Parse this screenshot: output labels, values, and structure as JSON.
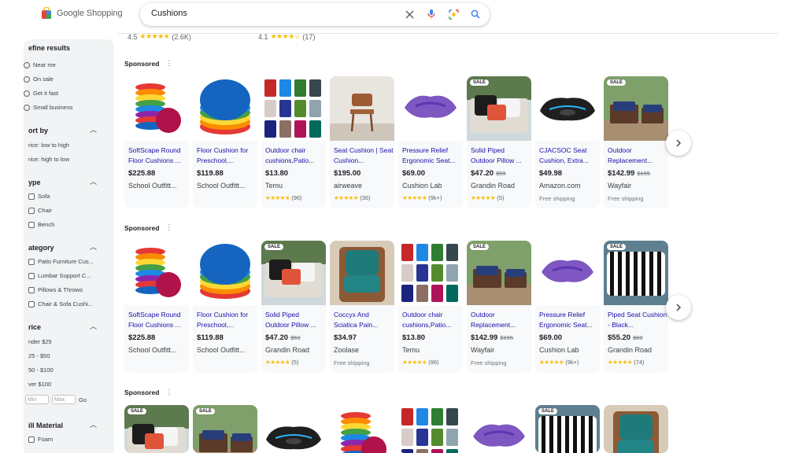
{
  "header": {
    "brand": "Google Shopping",
    "search_value": "Cushions",
    "icons": [
      "close-icon",
      "mic-icon",
      "lens-icon",
      "search-icon"
    ]
  },
  "above_fold": [
    {
      "rating": "4.5",
      "stars": "★★★★★",
      "count": "(2.6K)"
    },
    {
      "rating": "4.1",
      "stars": "★★★★☆",
      "count": "(17)"
    }
  ],
  "sidebar": {
    "title": "efine results",
    "quick": [
      "Near me",
      "On sale",
      "Get it fast",
      "Small business"
    ],
    "sort_heading": "ort by",
    "sort_options": [
      "rice: low to high",
      "rice: high to low"
    ],
    "type_heading": "ype",
    "type_options": [
      "Sofa",
      "Chair",
      "Bench"
    ],
    "category_heading": "ategory",
    "category_options": [
      "Patio Furniture Cus...",
      "Lumbar Support C...",
      "Pillows & Throws",
      "Chair & Sofa Cushi..."
    ],
    "price_heading": "rice",
    "price_options": [
      "nder $25",
      "25 - $50",
      "50 - $100",
      "ver $100"
    ],
    "price_min": "Min",
    "price_max": "Max",
    "price_go": "Go",
    "material_heading": "ill Material",
    "material_options": [
      "Foam"
    ]
  },
  "sponsored_label": "Sponsored",
  "rows": [
    [
      {
        "title": "SoftScape Round Floor Cushions ...",
        "price": "$225.88",
        "old": "",
        "store": "School Outfitt...",
        "stars": "",
        "reviews": "",
        "ship": "",
        "sale": "",
        "img": "stack"
      },
      {
        "title": "Floor Cushion for Preschool,...",
        "price": "$119.88",
        "old": "",
        "store": "School Outfitt...",
        "stars": "",
        "reviews": "",
        "ship": "",
        "sale": "",
        "img": "round"
      },
      {
        "title": "Outdoor chair cushions,Patio...",
        "price": "$13.80",
        "old": "",
        "store": "Temu",
        "stars": "★★★★★",
        "reviews": "(96)",
        "ship": "",
        "sale": "",
        "img": "grid"
      },
      {
        "title": "Seat Cushion | Seat Cushion...",
        "price": "$195.00",
        "old": "",
        "store": "airweave",
        "stars": "★★★★★",
        "reviews": "(36)",
        "ship": "",
        "sale": "",
        "img": "chair"
      },
      {
        "title": "Pressure Relief Ergonomic Seat...",
        "price": "$69.00",
        "old": "",
        "store": "Cushion Lab",
        "stars": "★★★★★",
        "reviews": "(9k+)",
        "ship": "",
        "sale": "",
        "img": "purple"
      },
      {
        "title": "Solid Piped Outdoor Pillow ...",
        "price": "$47.20",
        "old": "$59",
        "store": "Grandin Road",
        "stars": "★★★★★",
        "reviews": "(5)",
        "ship": "",
        "sale": "SALE",
        "img": "pillows"
      },
      {
        "title": "CJACSOC Seat Cushion, Extra...",
        "price": "$49.98",
        "old": "",
        "store": "Amazon.com",
        "stars": "",
        "reviews": "",
        "ship": "Free shipping",
        "sale": "",
        "img": "black"
      },
      {
        "title": "Outdoor Replacement...",
        "price": "$142.99",
        "old": "$155",
        "store": "Wayfair",
        "stars": "",
        "reviews": "",
        "ship": "Free shipping",
        "sale": "SALE",
        "img": "patio"
      }
    ],
    [
      {
        "title": "SoftScape Round Floor Cushions ...",
        "price": "$225.88",
        "old": "",
        "store": "School Outfitt...",
        "stars": "",
        "reviews": "",
        "ship": "",
        "sale": "",
        "img": "stack"
      },
      {
        "title": "Floor Cushion for Preschool,...",
        "price": "$119.88",
        "old": "",
        "store": "School Outfitt...",
        "stars": "",
        "reviews": "",
        "ship": "",
        "sale": "",
        "img": "round"
      },
      {
        "title": "Solid Piped Outdoor Pillow ...",
        "price": "$47.20",
        "old": "$59",
        "store": "Grandin Road",
        "stars": "★★★★★",
        "reviews": "(5)",
        "ship": "",
        "sale": "SALE",
        "img": "pillows"
      },
      {
        "title": "Coccyx And Sciatica Pain...",
        "price": "$34.97",
        "old": "",
        "store": "Zoolase",
        "stars": "",
        "reviews": "",
        "ship": "Free shipping",
        "sale": "",
        "img": "teal"
      },
      {
        "title": "Outdoor chair cushions,Patio...",
        "price": "$13.80",
        "old": "",
        "store": "Temu",
        "stars": "★★★★★",
        "reviews": "(96)",
        "ship": "",
        "sale": "",
        "img": "grid"
      },
      {
        "title": "Outdoor Replacement...",
        "price": "$142.99",
        "old": "$155",
        "store": "Wayfair",
        "stars": "",
        "reviews": "",
        "ship": "Free shipping",
        "sale": "SALE",
        "img": "patio"
      },
      {
        "title": "Pressure Relief Ergonomic Seat...",
        "price": "$69.00",
        "old": "",
        "store": "Cushion Lab",
        "stars": "★★★★★",
        "reviews": "(9k+)",
        "ship": "",
        "sale": "",
        "img": "purple"
      },
      {
        "title": "Piped Seat Cushion - Black...",
        "price": "$55.20",
        "old": "$69",
        "store": "Grandin Road",
        "stars": "★★★★★",
        "reviews": "(74)",
        "ship": "",
        "sale": "SALE",
        "img": "stripes"
      }
    ],
    [
      {
        "sale": "SALE",
        "img": "pillows"
      },
      {
        "sale": "SALE",
        "img": "patio"
      },
      {
        "sale": "",
        "img": "black"
      },
      {
        "sale": "",
        "img": "stack"
      },
      {
        "sale": "",
        "img": "grid"
      },
      {
        "sale": "",
        "img": "purple"
      },
      {
        "sale": "SALE",
        "img": "stripes"
      },
      {
        "sale": "",
        "img": "teal"
      }
    ]
  ],
  "colors": {
    "link": "#1a0dab",
    "star": "#fbbc04",
    "sidebar_bg": "#f1f3f4"
  }
}
